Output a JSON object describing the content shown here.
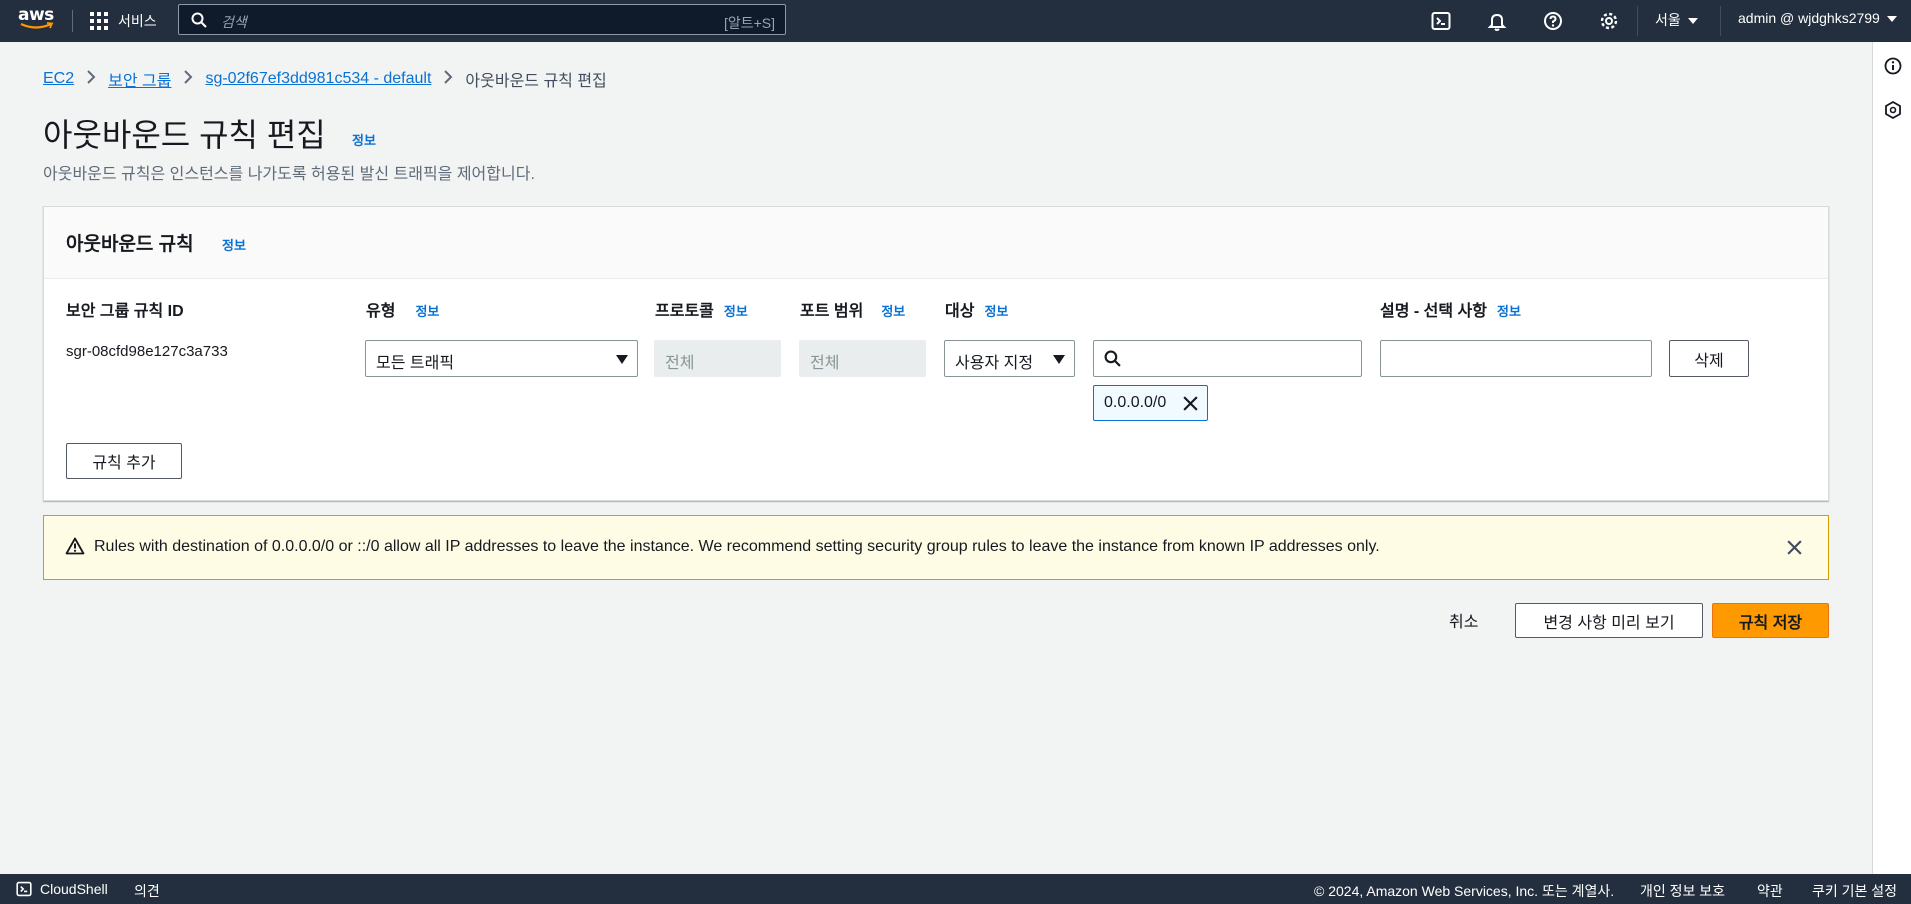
{
  "topnav": {
    "logo_text": "aws",
    "services_label": "서비스",
    "search_placeholder": "검색",
    "search_shortcut": "[알트+S]",
    "region_label": "서울",
    "account_label": "admin @ wjdghks2799"
  },
  "breadcrumb": {
    "items": [
      "EC2",
      "보안 그룹",
      "sg-02f67ef3dd981c534 - default"
    ],
    "current": "아웃바운드 규칙 편집"
  },
  "page": {
    "title": "아웃바운드 규칙 편집",
    "info_label": "정보",
    "description": "아웃바운드 규칙은 인스턴스를 나가도록 허용된 발신 트래픽을 제어합니다."
  },
  "panel": {
    "title": "아웃바운드 규칙",
    "info_label": "정보",
    "columns": {
      "rule_id": "보안 그룹 규칙 ID",
      "type": "유형",
      "protocol": "프로토콜",
      "port_range": "포트 범위",
      "destination": "대상",
      "description": "설명 - 선택 사항"
    },
    "rule": {
      "id": "sgr-08cfd98e127c3a733",
      "type": "모든 트래픽",
      "protocol": "전체",
      "port_range": "전체",
      "destination_type": "사용자 지정",
      "destination_token": "0.0.0.0/0",
      "delete_label": "삭제"
    },
    "add_rule_label": "규칙 추가"
  },
  "warning": {
    "text": "Rules with destination of 0.0.0.0/0 or ::/0 allow all IP addresses to leave the instance. We recommend setting security group rules to leave the instance from known IP addresses only."
  },
  "actions": {
    "cancel": "취소",
    "preview": "변경 사항 미리 보기",
    "save": "규칙 저장"
  },
  "footer": {
    "cloudshell": "CloudShell",
    "feedback": "의견",
    "copyright": "© 2024, Amazon Web Services, Inc. 또는 계열사.",
    "privacy": "개인 정보 보호",
    "terms": "약관",
    "cookies": "쿠키 기본 설정"
  },
  "colors": {
    "nav_bg": "#232f3e",
    "link": "#0972d3",
    "primary": "#ff9900",
    "warning_bg": "#fffce6",
    "warning_border": "#d19d00"
  }
}
